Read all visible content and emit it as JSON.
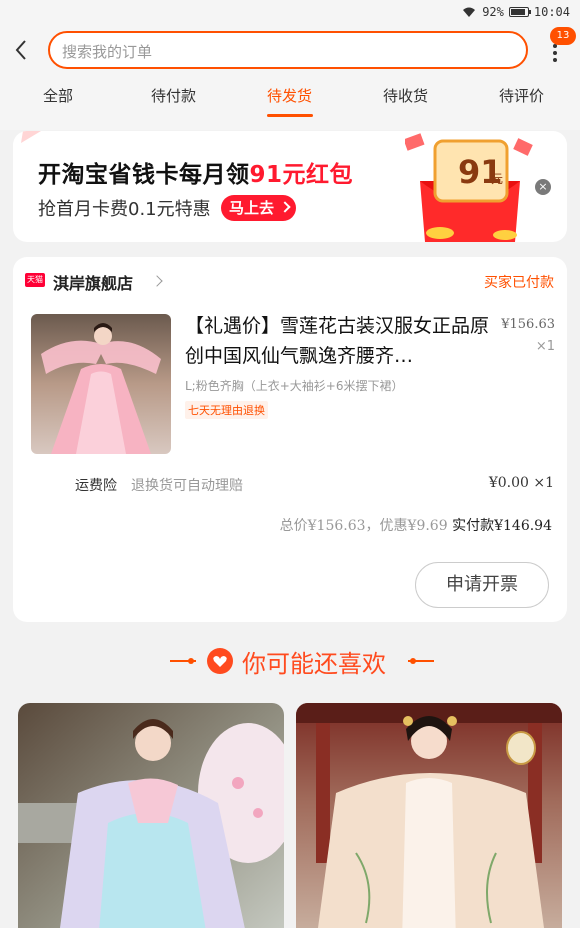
{
  "status_bar": {
    "battery": "92%",
    "time": "10:04"
  },
  "header": {
    "search_placeholder": "搜索我的订单",
    "badge_count": "13"
  },
  "tabs": [
    {
      "label": "全部",
      "active": false
    },
    {
      "label": "待付款",
      "active": false
    },
    {
      "label": "待发货",
      "active": true
    },
    {
      "label": "待收货",
      "active": false
    },
    {
      "label": "待评价",
      "active": false
    }
  ],
  "promo": {
    "title_prefix": "开淘宝省钱卡每月领",
    "title_highlight": "91元红包",
    "subtitle": "抢首月卡费0.1元特惠",
    "button_label": "马上去",
    "badge_amount": "91",
    "badge_unit": "元"
  },
  "order": {
    "shop_logo_text": "天猫",
    "shop_name": "淇岸旗舰店",
    "status": "买家已付款",
    "product_title": "【礼遇价】雪莲花古装汉服女正品原创中国风仙气飘逸齐腰齐…",
    "price": "¥156.63",
    "quantity": "×1",
    "sku": "L;粉色齐胸（上衣+大袖衫+6米摆下裙）",
    "tag": "七天无理由退换",
    "insurance_label": "运费险",
    "insurance_desc": "退换货可自动理赔",
    "insurance_price": "¥0.00 ×1",
    "total_label": "总价",
    "total_value": "¥156.63",
    "discount_label": "，优惠",
    "discount_value": "¥9.69",
    "paid_label": "实付款",
    "paid_value": "¥146.94",
    "invoice_button": "申请开票"
  },
  "recommend": {
    "title": "你可能还喜欢"
  },
  "colors": {
    "accent": "#ff5000",
    "promo_red": "#ff1a2f",
    "tmall_red": "#ff0036"
  }
}
